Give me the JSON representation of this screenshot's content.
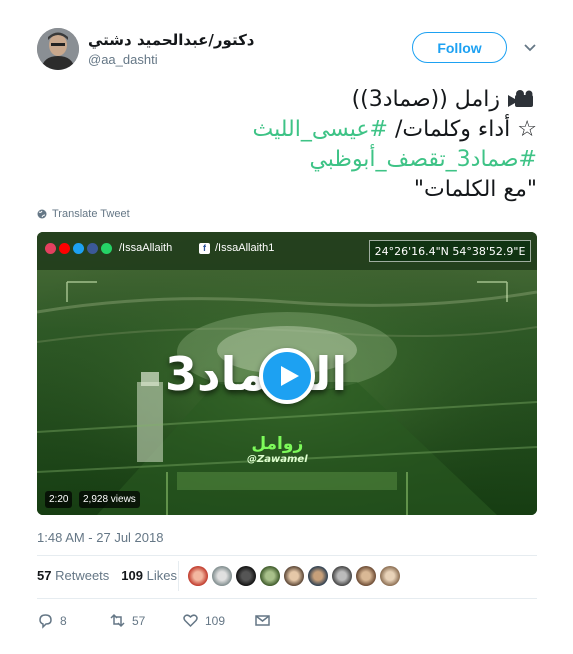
{
  "author": {
    "display_name": "دكتور/عبدالحميد دشتي",
    "handle": "@aa_dashti"
  },
  "follow_label": "Follow",
  "tweet": {
    "line1_text": "زامل ((صماد3))",
    "line1_icon": "video-camera-icon",
    "line2_text": "☆ أداء وكلمات/ ",
    "line2_hashtag": "#عيسى_الليث",
    "line3_hashtag": "#صماد3_تقصف_أبوظبي",
    "line4_text": "\"مع الكلمات\""
  },
  "translate_label": "Translate Tweet",
  "video": {
    "social_handle_1": "/IssaAllaith",
    "social_handle_2": "/IssaAllaith1",
    "coordinates": "24°26'16.4\"N 54°38'52.9\"E",
    "overlay_title": "الصماد3",
    "brand_arabic": "زوامل",
    "brand_latin": "@Zawamel",
    "duration": "2:20",
    "views": "2,928 views",
    "colors": {
      "social_dots": [
        "#e4405f",
        "#ff0000",
        "#1da1f2",
        "#3b5998",
        "#25d366"
      ]
    }
  },
  "timestamp": "1:48 AM - 27 Jul 2018",
  "stats": {
    "retweets_count": "57",
    "retweets_label": "Retweets",
    "likes_count": "109",
    "likes_label": "Likes"
  },
  "actions": {
    "reply_count": "8",
    "retweet_count": "57",
    "like_count": "109"
  },
  "colors": {
    "accent": "#1da1f2",
    "hashtag_green": "#3ec386",
    "muted": "#657786"
  }
}
